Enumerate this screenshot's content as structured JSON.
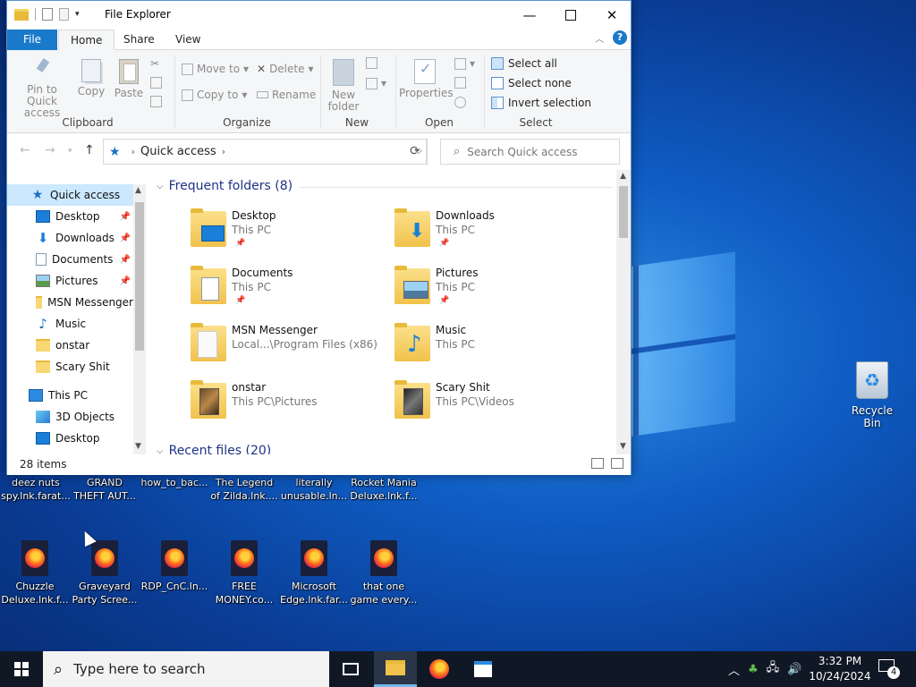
{
  "window": {
    "title": "File Explorer"
  },
  "ribbon_tabs": [
    "File",
    "Home",
    "Share",
    "View"
  ],
  "ribbon": {
    "clipboard": {
      "pin": "Pin to Quick access",
      "copy": "Copy",
      "paste": "Paste",
      "label": "Clipboard"
    },
    "organize": {
      "move_to": "Move to",
      "copy_to": "Copy to",
      "delete": "Delete",
      "rename": "Rename",
      "label": "Organize"
    },
    "new": {
      "new_folder": "New folder",
      "label": "New"
    },
    "open": {
      "properties": "Properties",
      "label": "Open"
    },
    "select": {
      "select_all": "Select all",
      "select_none": "Select none",
      "invert": "Invert selection",
      "label": "Select"
    }
  },
  "address": {
    "location": "Quick access",
    "search_placeholder": "Search Quick access"
  },
  "nav_pane": {
    "quick_access": "Quick access",
    "items": [
      {
        "label": "Desktop",
        "pinned": true
      },
      {
        "label": "Downloads",
        "pinned": true
      },
      {
        "label": "Documents",
        "pinned": true
      },
      {
        "label": "Pictures",
        "pinned": true
      },
      {
        "label": "MSN Messenger",
        "pinned": false
      },
      {
        "label": "Music",
        "pinned": false
      },
      {
        "label": "onstar",
        "pinned": false
      },
      {
        "label": "Scary Shit",
        "pinned": false
      }
    ],
    "this_pc": "This PC",
    "this_pc_items": [
      "3D Objects",
      "Desktop"
    ]
  },
  "content": {
    "frequent_header": "Frequent folders (8)",
    "folders": [
      {
        "name": "Desktop",
        "location": "This PC",
        "pinned": true
      },
      {
        "name": "Downloads",
        "location": "This PC",
        "pinned": true
      },
      {
        "name": "Documents",
        "location": "This PC",
        "pinned": true
      },
      {
        "name": "Pictures",
        "location": "This PC",
        "pinned": true
      },
      {
        "name": "MSN Messenger",
        "location": "Local...\\Program Files (x86)",
        "pinned": false
      },
      {
        "name": "Music",
        "location": "This PC",
        "pinned": false
      },
      {
        "name": "onstar",
        "location": "This PC\\Pictures",
        "pinned": false
      },
      {
        "name": "Scary Shit",
        "location": "This PC\\Videos",
        "pinned": false
      }
    ],
    "recent_header": "Recent files (20)"
  },
  "status": {
    "item_count": "28 items"
  },
  "desktop_icons": [
    {
      "label": "deez nuts spy.lnk.farat..."
    },
    {
      "label": "GRAND THEFT AUT..."
    },
    {
      "label": "how_to_bac..."
    },
    {
      "label": "The Legend of Zilda.lnk...."
    },
    {
      "label": "literally unusable.ln..."
    },
    {
      "label": "Rocket Mania Deluxe.lnk.f..."
    },
    {
      "label": "Chuzzle Deluxe.lnk.f..."
    },
    {
      "label": "Graveyard Party Scree..."
    },
    {
      "label": "RDP_CnC.ln..."
    },
    {
      "label": "FREE MONEY.co..."
    },
    {
      "label": "Microsoft Edge.lnk.far..."
    },
    {
      "label": "that one game every..."
    }
  ],
  "recycle_bin": "Recycle Bin",
  "taskbar": {
    "search_placeholder": "Type here to search",
    "time": "3:32 PM",
    "date": "10/24/2024",
    "notification_count": "4"
  },
  "icons": {
    "help": "?",
    "recent_chevron": "⌵"
  }
}
